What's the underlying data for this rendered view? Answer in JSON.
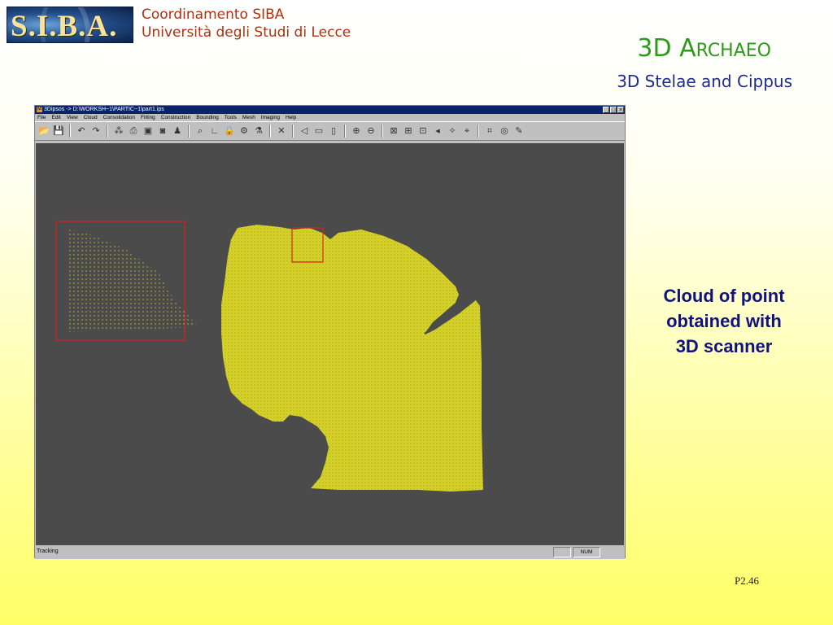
{
  "slide": {
    "logo_text": "S.I.B.A.",
    "org_line1": "Coordinamento SIBA",
    "org_line2": "Università degli Studi di Lecce",
    "title_3d": "3D A",
    "title_rchaeo": "RCHAEO",
    "subtitle": "3D Stelae and Cippus",
    "caption_line1": "Cloud of point",
    "caption_line2": "obtained with",
    "caption_line3": "3D scanner",
    "page_number": "P2.46"
  },
  "app": {
    "window_title": "3Dipsos -> D:\\WORKSH~1\\PARTIC~1\\part1.ips",
    "menu": [
      "File",
      "Edit",
      "View",
      "Cloud",
      "Consolidation",
      "Fitting",
      "Construction",
      "Bounding",
      "Tools",
      "Mesh",
      "Imaging",
      "Help"
    ],
    "status_text": "Tracking",
    "status_num": "NUM",
    "colors": {
      "viewport_bg": "#4b4b4b",
      "point_cloud": "#d8d42a",
      "selection_box": "#d82020",
      "titlebar": "#0a246a"
    },
    "toolbar_icons": [
      "open-icon",
      "save-icon",
      "undo-icon",
      "redo-icon",
      "cloud-icon",
      "print-icon",
      "view-icon",
      "camera-icon",
      "person-icon",
      "zoom-icon",
      "axes-icon",
      "lock-icon",
      "gear-icon",
      "filter-icon",
      "delete-icon",
      "back-icon",
      "shape-icon",
      "bar-icon",
      "zoom-in-icon",
      "zoom-out-icon",
      "delete-view-icon",
      "mesh-icon",
      "measure-icon",
      "arrow-icon",
      "pick-icon",
      "select-icon",
      "bounding-icon",
      "scan-icon",
      "tool-icon"
    ]
  }
}
